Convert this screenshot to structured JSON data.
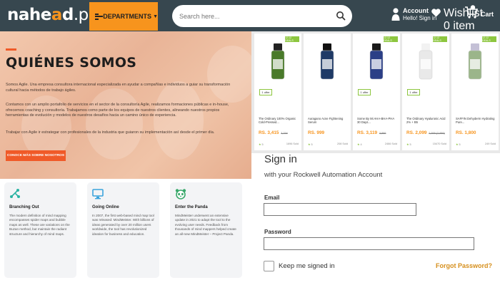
{
  "header": {
    "logo_main": "nahe",
    "logo_mid": "a",
    "logo_end": "d",
    "logo_suffix": ".pk",
    "departments_label": "DEPARTMENTS",
    "search_placeholder": "Search here...",
    "account_label": "Account",
    "account_sub": "Hello! Sign in",
    "wishlist_label": "Wishlist",
    "wishlist_sub": "0 item",
    "cart_label": "Cart",
    "brand_color": "#f7941d",
    "bar_color": "#37474f"
  },
  "about": {
    "title": "QUIÉNES SOMOS",
    "para1": "Somos Agile. Una empresa consultora internacional especializada en ayudar a compañías e individuos a guiar su transformación cultural hacia métodos de trabajo ágiles.",
    "para2": "Contamos con un amplio portafolio de servicios en el sector de la consultoría Agile, realizamos formaciones públicas e in-house, ofrecemos coaching y consultoría. Trabajamos como parte de los equipos de nuestros clientes, alineando nuestros propios herramientas de evolución y modelos de nuestros desafíos hacia un camino único de experiencia.",
    "para3": "Trabajar con Agile ir estrategar con profesionales de la industria que guiaron su implementación así desde el primer día.",
    "cta_label": "CONOCE MÁS SOBRE NOSOTROS",
    "accent_color": "#f05a28"
  },
  "features": [
    {
      "icon": "branching-icon",
      "title": "Branching Out",
      "text": "The modern definition of mind mapping encompasses spider maps and bubble maps as well. These are variations on the Buzan method, but maintain the radiant structure and hierarchy of mind maps."
    },
    {
      "icon": "monitor-icon",
      "title": "Going Online",
      "text": "In 2007, the first web-based mind map tool was released: MindMeister. With billions of ideas generated by over 20 million users worldwide, the tool has revolutionized ideation for business and education."
    },
    {
      "icon": "panda-icon",
      "title": "Enter the Panda",
      "text": "MindMeister underwent an extensive update in 2021 to adapt the tool to the evolving user needs. Feedback from thousands of mind mappers helped create an all-new MindMeister – Project Panda."
    }
  ],
  "products": [
    {
      "promo": "12.12 DEALS",
      "offer": "1 offer",
      "name": "The Ordinary 100% Organic Cold-Pressed...",
      "price": "RS. 3,415",
      "old": "3,794",
      "rating": "5",
      "sold": "1696 Sold",
      "bottle_color": "#4a7a2a",
      "cap_color": "#222222"
    },
    {
      "promo": "",
      "offer": "",
      "name": "Auragano Acne Fightening Serum",
      "price": "RS. 999",
      "old": "",
      "rating": "5",
      "sold": "208 Sold",
      "bottle_color": "#1f3a66",
      "cap_color": "#111111"
    },
    {
      "promo": "12.12 DEALS",
      "offer": "1 offer",
      "name": "Some By Mi AHA-BHA-PHA 30 Days...",
      "price": "RS. 3,119",
      "old": "3,899",
      "rating": "4",
      "sold": "2466 Sold",
      "bottle_color": "#2b3f86",
      "cap_color": "#1a1a1a"
    },
    {
      "promo": "12.12 DEALS",
      "offer": "1 offer",
      "name": "The Ordinary Hyaluronic Acid 2% + B5",
      "price": "RS. 2,099",
      "old": "2,999 (2,999)",
      "rating": "5",
      "sold": "15470 Sold",
      "bottle_color": "#e9e9e9",
      "cap_color": "#f2f2f2"
    },
    {
      "promo": "12.12 DEALS",
      "offer": "",
      "name": "SAFFIN Dehyderm Hydrating Pure...",
      "price": "RS. 1,800",
      "old": "",
      "rating": "5",
      "sold": "249 Sold",
      "bottle_color": "#9bb58a",
      "cap_color": "#c4c0d6"
    }
  ],
  "signin": {
    "title": "Sign in",
    "subtitle": "with your Rockwell Automation Account",
    "email_label": "Email",
    "email_value": "",
    "password_label": "Password",
    "password_value": "",
    "remember_label": "Keep me signed in",
    "forgot_label": "Forgot Password?"
  }
}
